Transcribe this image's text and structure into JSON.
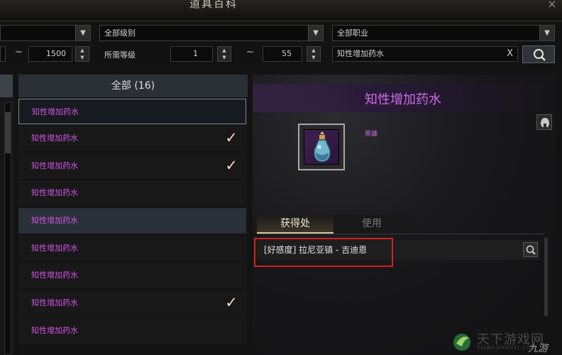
{
  "window": {
    "title": "道具百科",
    "close": "×"
  },
  "filters": {
    "category_select": "",
    "grade_select": "全部级别",
    "class_select": "全部职业",
    "tilde": "~",
    "left_range_max": "1500",
    "level_label": "所需等级",
    "level_min": "1",
    "level_max": "55",
    "search_value": "知性增加药水",
    "clear": "X"
  },
  "list": {
    "header": "全部 (16)",
    "items": [
      {
        "label": "知性增加药水",
        "checked": false,
        "state": "selected"
      },
      {
        "label": "知性增加药水",
        "checked": true,
        "state": "normal"
      },
      {
        "label": "知性增加药水",
        "checked": true,
        "state": "normal"
      },
      {
        "label": "知性增加药水",
        "checked": false,
        "state": "normal"
      },
      {
        "label": "知性增加药水",
        "checked": false,
        "state": "highlight"
      },
      {
        "label": "知性增加药水",
        "checked": false,
        "state": "normal"
      },
      {
        "label": "知性增加药水",
        "checked": false,
        "state": "normal"
      },
      {
        "label": "知性增加药水",
        "checked": true,
        "state": "normal"
      },
      {
        "label": "知性增加药水",
        "checked": false,
        "state": "normal"
      }
    ]
  },
  "detail": {
    "title": "知性增加药水",
    "grade": "英雄",
    "tabs": {
      "obtain": "获得处",
      "use": "使用"
    },
    "obtain_source": "[好感度] 拉尼亚镇 - 吉迪恩"
  },
  "watermark": {
    "text": "天下游戏网",
    "sub": "TIANXIAYOUXI.COM",
    "brand": "九游"
  },
  "colors": {
    "item_purple": "#cf54e5",
    "highlight_red": "#d4201d"
  }
}
